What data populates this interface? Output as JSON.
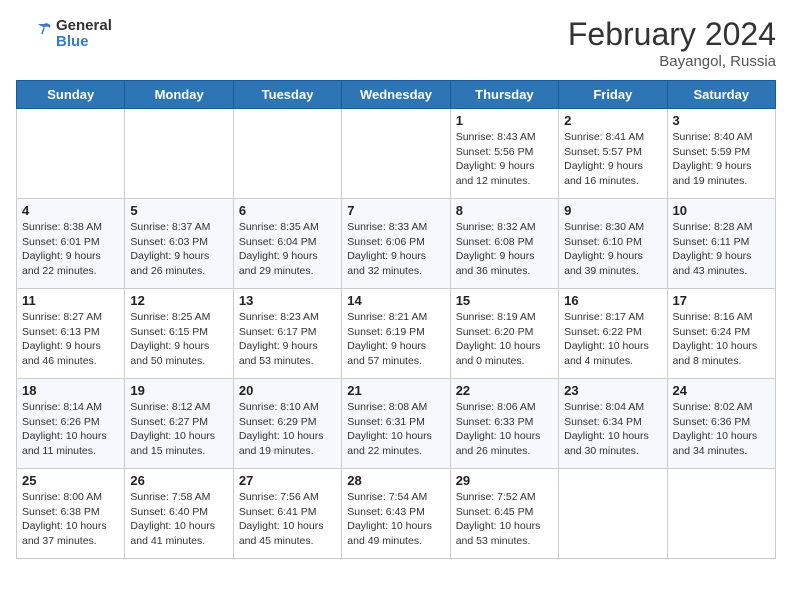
{
  "header": {
    "logo_general": "General",
    "logo_blue": "Blue",
    "title": "February 2024",
    "subtitle": "Bayangol, Russia"
  },
  "days": [
    "Sunday",
    "Monday",
    "Tuesday",
    "Wednesday",
    "Thursday",
    "Friday",
    "Saturday"
  ],
  "weeks": [
    [
      {
        "date": "",
        "info": ""
      },
      {
        "date": "",
        "info": ""
      },
      {
        "date": "",
        "info": ""
      },
      {
        "date": "",
        "info": ""
      },
      {
        "date": "1",
        "info": "Sunrise: 8:43 AM\nSunset: 5:56 PM\nDaylight: 9 hours\nand 12 minutes."
      },
      {
        "date": "2",
        "info": "Sunrise: 8:41 AM\nSunset: 5:57 PM\nDaylight: 9 hours\nand 16 minutes."
      },
      {
        "date": "3",
        "info": "Sunrise: 8:40 AM\nSunset: 5:59 PM\nDaylight: 9 hours\nand 19 minutes."
      }
    ],
    [
      {
        "date": "4",
        "info": "Sunrise: 8:38 AM\nSunset: 6:01 PM\nDaylight: 9 hours\nand 22 minutes."
      },
      {
        "date": "5",
        "info": "Sunrise: 8:37 AM\nSunset: 6:03 PM\nDaylight: 9 hours\nand 26 minutes."
      },
      {
        "date": "6",
        "info": "Sunrise: 8:35 AM\nSunset: 6:04 PM\nDaylight: 9 hours\nand 29 minutes."
      },
      {
        "date": "7",
        "info": "Sunrise: 8:33 AM\nSunset: 6:06 PM\nDaylight: 9 hours\nand 32 minutes."
      },
      {
        "date": "8",
        "info": "Sunrise: 8:32 AM\nSunset: 6:08 PM\nDaylight: 9 hours\nand 36 minutes."
      },
      {
        "date": "9",
        "info": "Sunrise: 8:30 AM\nSunset: 6:10 PM\nDaylight: 9 hours\nand 39 minutes."
      },
      {
        "date": "10",
        "info": "Sunrise: 8:28 AM\nSunset: 6:11 PM\nDaylight: 9 hours\nand 43 minutes."
      }
    ],
    [
      {
        "date": "11",
        "info": "Sunrise: 8:27 AM\nSunset: 6:13 PM\nDaylight: 9 hours\nand 46 minutes."
      },
      {
        "date": "12",
        "info": "Sunrise: 8:25 AM\nSunset: 6:15 PM\nDaylight: 9 hours\nand 50 minutes."
      },
      {
        "date": "13",
        "info": "Sunrise: 8:23 AM\nSunset: 6:17 PM\nDaylight: 9 hours\nand 53 minutes."
      },
      {
        "date": "14",
        "info": "Sunrise: 8:21 AM\nSunset: 6:19 PM\nDaylight: 9 hours\nand 57 minutes."
      },
      {
        "date": "15",
        "info": "Sunrise: 8:19 AM\nSunset: 6:20 PM\nDaylight: 10 hours\nand 0 minutes."
      },
      {
        "date": "16",
        "info": "Sunrise: 8:17 AM\nSunset: 6:22 PM\nDaylight: 10 hours\nand 4 minutes."
      },
      {
        "date": "17",
        "info": "Sunrise: 8:16 AM\nSunset: 6:24 PM\nDaylight: 10 hours\nand 8 minutes."
      }
    ],
    [
      {
        "date": "18",
        "info": "Sunrise: 8:14 AM\nSunset: 6:26 PM\nDaylight: 10 hours\nand 11 minutes."
      },
      {
        "date": "19",
        "info": "Sunrise: 8:12 AM\nSunset: 6:27 PM\nDaylight: 10 hours\nand 15 minutes."
      },
      {
        "date": "20",
        "info": "Sunrise: 8:10 AM\nSunset: 6:29 PM\nDaylight: 10 hours\nand 19 minutes."
      },
      {
        "date": "21",
        "info": "Sunrise: 8:08 AM\nSunset: 6:31 PM\nDaylight: 10 hours\nand 22 minutes."
      },
      {
        "date": "22",
        "info": "Sunrise: 8:06 AM\nSunset: 6:33 PM\nDaylight: 10 hours\nand 26 minutes."
      },
      {
        "date": "23",
        "info": "Sunrise: 8:04 AM\nSunset: 6:34 PM\nDaylight: 10 hours\nand 30 minutes."
      },
      {
        "date": "24",
        "info": "Sunrise: 8:02 AM\nSunset: 6:36 PM\nDaylight: 10 hours\nand 34 minutes."
      }
    ],
    [
      {
        "date": "25",
        "info": "Sunrise: 8:00 AM\nSunset: 6:38 PM\nDaylight: 10 hours\nand 37 minutes."
      },
      {
        "date": "26",
        "info": "Sunrise: 7:58 AM\nSunset: 6:40 PM\nDaylight: 10 hours\nand 41 minutes."
      },
      {
        "date": "27",
        "info": "Sunrise: 7:56 AM\nSunset: 6:41 PM\nDaylight: 10 hours\nand 45 minutes."
      },
      {
        "date": "28",
        "info": "Sunrise: 7:54 AM\nSunset: 6:43 PM\nDaylight: 10 hours\nand 49 minutes."
      },
      {
        "date": "29",
        "info": "Sunrise: 7:52 AM\nSunset: 6:45 PM\nDaylight: 10 hours\nand 53 minutes."
      },
      {
        "date": "",
        "info": ""
      },
      {
        "date": "",
        "info": ""
      }
    ]
  ]
}
